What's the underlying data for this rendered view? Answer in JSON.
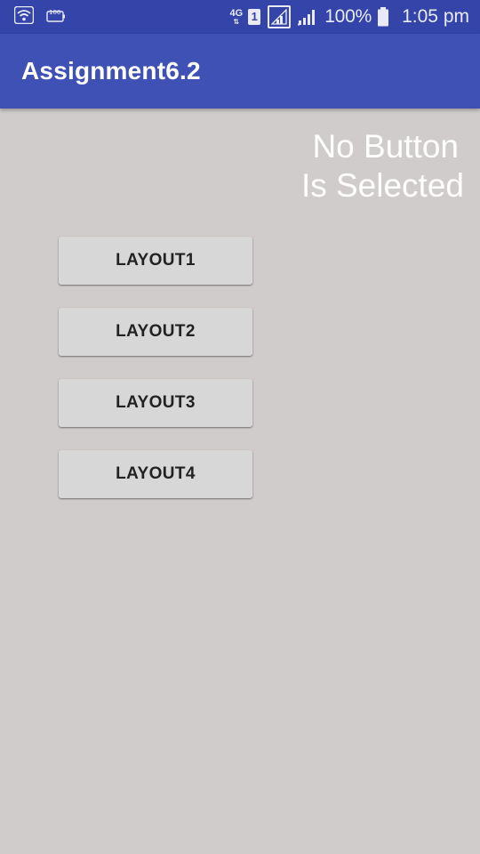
{
  "status_bar": {
    "network_type": "4G",
    "network_arrows": "⇅",
    "sim_slot": "1",
    "battery_percent": "100%",
    "time": "1:05 pm",
    "icons": [
      "wifi-icon",
      "battery-saver-icon",
      "sim-icon",
      "signal-framed-icon",
      "signal-icon",
      "battery-icon"
    ]
  },
  "app_bar": {
    "title": "Assignment6.2",
    "color": "#3f51b5"
  },
  "main": {
    "status_line1": "No Button",
    "status_line2": "Is Selected",
    "buttons": [
      {
        "label": "LAYOUT1"
      },
      {
        "label": "LAYOUT2"
      },
      {
        "label": "LAYOUT3"
      },
      {
        "label": "LAYOUT4"
      }
    ]
  },
  "colors": {
    "status_bar": "#3444a8",
    "background": "#d0cccb",
    "button": "#d7d7d7",
    "status_text": "#ffffff"
  }
}
